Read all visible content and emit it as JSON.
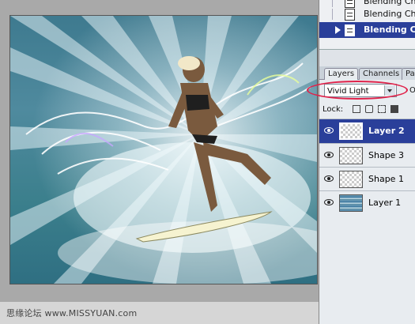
{
  "history": {
    "items": [
      {
        "label": "Blending Cha"
      },
      {
        "label": "Blending Chan"
      },
      {
        "label": "Blending Cha",
        "active": true
      }
    ]
  },
  "tabs": [
    {
      "label": "Layers",
      "active": true
    },
    {
      "label": "Channels"
    },
    {
      "label": "Pa"
    }
  ],
  "layers_panel": {
    "blend_mode": "Vivid Light",
    "opacity_label": "Op",
    "lock_label": "Lock:",
    "layers": [
      {
        "name": "Layer 2",
        "selected": true
      },
      {
        "name": "Shape 3"
      },
      {
        "name": "Shape 1"
      },
      {
        "name": "Layer 1"
      }
    ]
  },
  "watermark": "思缘论坛  www.MISSYUAN.com",
  "colors": {
    "selection": "#2a3f9a",
    "highlight_ring": "#e0224a",
    "panel_bg": "#e8ecf0"
  }
}
